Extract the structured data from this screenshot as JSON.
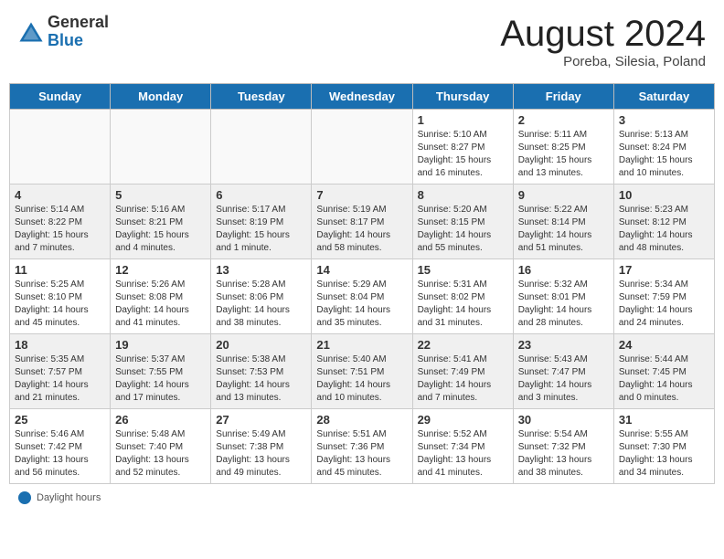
{
  "header": {
    "logo_line1": "General",
    "logo_line2": "Blue",
    "main_title": "August 2024",
    "subtitle": "Poreba, Silesia, Poland"
  },
  "weekdays": [
    "Sunday",
    "Monday",
    "Tuesday",
    "Wednesday",
    "Thursday",
    "Friday",
    "Saturday"
  ],
  "weeks": [
    [
      {
        "day": "",
        "info": ""
      },
      {
        "day": "",
        "info": ""
      },
      {
        "day": "",
        "info": ""
      },
      {
        "day": "",
        "info": ""
      },
      {
        "day": "1",
        "info": "Sunrise: 5:10 AM\nSunset: 8:27 PM\nDaylight: 15 hours\nand 16 minutes."
      },
      {
        "day": "2",
        "info": "Sunrise: 5:11 AM\nSunset: 8:25 PM\nDaylight: 15 hours\nand 13 minutes."
      },
      {
        "day": "3",
        "info": "Sunrise: 5:13 AM\nSunset: 8:24 PM\nDaylight: 15 hours\nand 10 minutes."
      }
    ],
    [
      {
        "day": "4",
        "info": "Sunrise: 5:14 AM\nSunset: 8:22 PM\nDaylight: 15 hours\nand 7 minutes."
      },
      {
        "day": "5",
        "info": "Sunrise: 5:16 AM\nSunset: 8:21 PM\nDaylight: 15 hours\nand 4 minutes."
      },
      {
        "day": "6",
        "info": "Sunrise: 5:17 AM\nSunset: 8:19 PM\nDaylight: 15 hours\nand 1 minute."
      },
      {
        "day": "7",
        "info": "Sunrise: 5:19 AM\nSunset: 8:17 PM\nDaylight: 14 hours\nand 58 minutes."
      },
      {
        "day": "8",
        "info": "Sunrise: 5:20 AM\nSunset: 8:15 PM\nDaylight: 14 hours\nand 55 minutes."
      },
      {
        "day": "9",
        "info": "Sunrise: 5:22 AM\nSunset: 8:14 PM\nDaylight: 14 hours\nand 51 minutes."
      },
      {
        "day": "10",
        "info": "Sunrise: 5:23 AM\nSunset: 8:12 PM\nDaylight: 14 hours\nand 48 minutes."
      }
    ],
    [
      {
        "day": "11",
        "info": "Sunrise: 5:25 AM\nSunset: 8:10 PM\nDaylight: 14 hours\nand 45 minutes."
      },
      {
        "day": "12",
        "info": "Sunrise: 5:26 AM\nSunset: 8:08 PM\nDaylight: 14 hours\nand 41 minutes."
      },
      {
        "day": "13",
        "info": "Sunrise: 5:28 AM\nSunset: 8:06 PM\nDaylight: 14 hours\nand 38 minutes."
      },
      {
        "day": "14",
        "info": "Sunrise: 5:29 AM\nSunset: 8:04 PM\nDaylight: 14 hours\nand 35 minutes."
      },
      {
        "day": "15",
        "info": "Sunrise: 5:31 AM\nSunset: 8:02 PM\nDaylight: 14 hours\nand 31 minutes."
      },
      {
        "day": "16",
        "info": "Sunrise: 5:32 AM\nSunset: 8:01 PM\nDaylight: 14 hours\nand 28 minutes."
      },
      {
        "day": "17",
        "info": "Sunrise: 5:34 AM\nSunset: 7:59 PM\nDaylight: 14 hours\nand 24 minutes."
      }
    ],
    [
      {
        "day": "18",
        "info": "Sunrise: 5:35 AM\nSunset: 7:57 PM\nDaylight: 14 hours\nand 21 minutes."
      },
      {
        "day": "19",
        "info": "Sunrise: 5:37 AM\nSunset: 7:55 PM\nDaylight: 14 hours\nand 17 minutes."
      },
      {
        "day": "20",
        "info": "Sunrise: 5:38 AM\nSunset: 7:53 PM\nDaylight: 14 hours\nand 13 minutes."
      },
      {
        "day": "21",
        "info": "Sunrise: 5:40 AM\nSunset: 7:51 PM\nDaylight: 14 hours\nand 10 minutes."
      },
      {
        "day": "22",
        "info": "Sunrise: 5:41 AM\nSunset: 7:49 PM\nDaylight: 14 hours\nand 7 minutes."
      },
      {
        "day": "23",
        "info": "Sunrise: 5:43 AM\nSunset: 7:47 PM\nDaylight: 14 hours\nand 3 minutes."
      },
      {
        "day": "24",
        "info": "Sunrise: 5:44 AM\nSunset: 7:45 PM\nDaylight: 14 hours\nand 0 minutes."
      }
    ],
    [
      {
        "day": "25",
        "info": "Sunrise: 5:46 AM\nSunset: 7:42 PM\nDaylight: 13 hours\nand 56 minutes."
      },
      {
        "day": "26",
        "info": "Sunrise: 5:48 AM\nSunset: 7:40 PM\nDaylight: 13 hours\nand 52 minutes."
      },
      {
        "day": "27",
        "info": "Sunrise: 5:49 AM\nSunset: 7:38 PM\nDaylight: 13 hours\nand 49 minutes."
      },
      {
        "day": "28",
        "info": "Sunrise: 5:51 AM\nSunset: 7:36 PM\nDaylight: 13 hours\nand 45 minutes."
      },
      {
        "day": "29",
        "info": "Sunrise: 5:52 AM\nSunset: 7:34 PM\nDaylight: 13 hours\nand 41 minutes."
      },
      {
        "day": "30",
        "info": "Sunrise: 5:54 AM\nSunset: 7:32 PM\nDaylight: 13 hours\nand 38 minutes."
      },
      {
        "day": "31",
        "info": "Sunrise: 5:55 AM\nSunset: 7:30 PM\nDaylight: 13 hours\nand 34 minutes."
      }
    ]
  ],
  "footer": {
    "label": "Daylight hours"
  }
}
